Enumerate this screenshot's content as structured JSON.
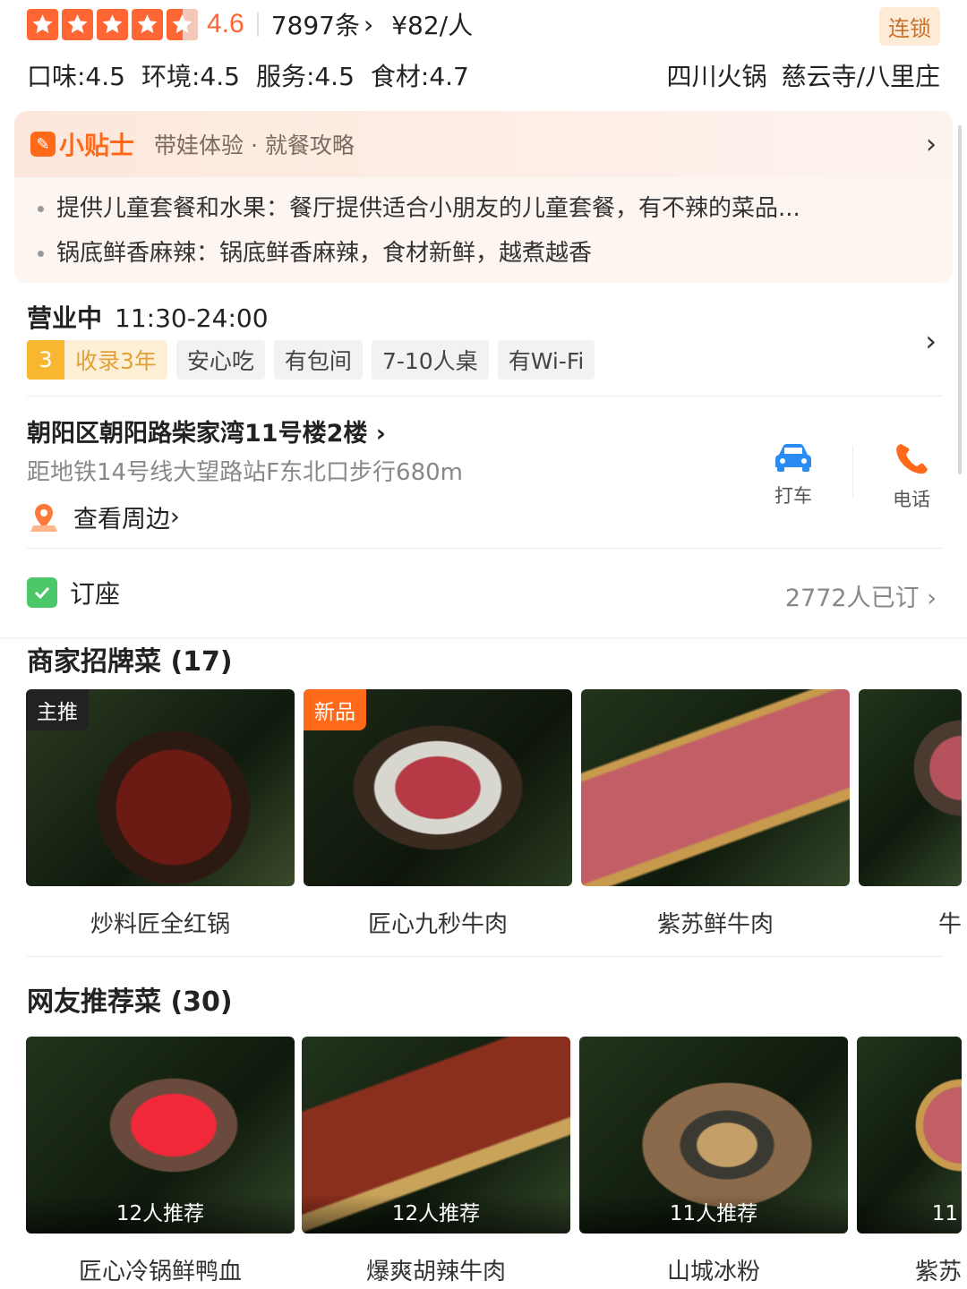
{
  "rating": {
    "stars": 4.5,
    "score": "4.6",
    "reviews": "7897条",
    "price": "¥82/人",
    "chain_badge": "连锁"
  },
  "sub_scores": {
    "taste": "口味:4.5",
    "environment": "环境:4.5",
    "service": "服务:4.5",
    "ingredients": "食材:4.7",
    "cuisine": "四川火锅",
    "area": "慈云寺/八里庄"
  },
  "tips": {
    "title": "小贴士",
    "subtitle": "带娃体验 · 就餐攻略",
    "items": [
      "提供儿童套餐和水果：餐厅提供适合小朋友的儿童套餐，有不辣的菜品...",
      "锅底鲜香麻辣：锅底鲜香麻辣，食材新鲜，越煮越香"
    ]
  },
  "hours": {
    "status": "营业中",
    "time": "11:30-24:00",
    "year_num": "3",
    "year_label": "收录3年",
    "tags": [
      "安心吃",
      "有包间",
      "7-10人桌",
      "有Wi-Fi"
    ]
  },
  "address": {
    "line": "朝阳区朝阳路柴家湾11号楼2楼",
    "metro": "距地铁14号线大望路站F东北口步行680m",
    "nearby": "查看周边",
    "taxi": "打车",
    "phone": "电话"
  },
  "reservation": {
    "label": "订座",
    "count": "2772人已订"
  },
  "signature": {
    "title": "商家招牌菜 (17)",
    "dishes": [
      {
        "name": "炒料匠全红锅",
        "badge": "主推"
      },
      {
        "name": "匠心九秒牛肉",
        "badge": "新品"
      },
      {
        "name": "紫苏鲜牛肉",
        "badge": ""
      },
      {
        "name": "牛",
        "badge": ""
      }
    ]
  },
  "recommended": {
    "title": "网友推荐菜 (30)",
    "dishes": [
      {
        "name": "匠心冷锅鲜鸭血",
        "rec": "12人推荐"
      },
      {
        "name": "爆爽胡辣牛肉",
        "rec": "12人推荐"
      },
      {
        "name": "山城冰粉",
        "rec": "11人推荐"
      },
      {
        "name": "紫苏",
        "rec": "11"
      }
    ]
  },
  "colors": {
    "accent": "#ff6633",
    "tips_orange": "#ff6a1a",
    "taxi_blue": "#2a8cf0",
    "green": "#4cc76a"
  }
}
